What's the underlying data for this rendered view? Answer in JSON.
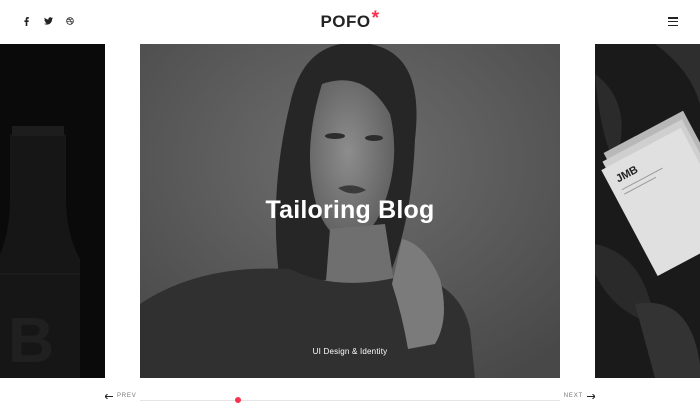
{
  "header": {
    "logo_text": "POFO",
    "logo_mark": "*",
    "social_icons": [
      "facebook-icon",
      "twitter-icon",
      "dribbble-icon"
    ],
    "menu_icon": "hamburger-menu-icon",
    "accent_color": "#f7324e"
  },
  "slider": {
    "main_slide": {
      "title": "Tailoring Blog",
      "subtitle": "UI Design & Identity"
    },
    "right_slide": {
      "brand_text": "JMB"
    },
    "left_slide": {
      "label_letter": "B"
    }
  },
  "navigation": {
    "prev_label": "PREV",
    "next_label": "NEXT",
    "active_indicator_color": "#f7324e"
  }
}
